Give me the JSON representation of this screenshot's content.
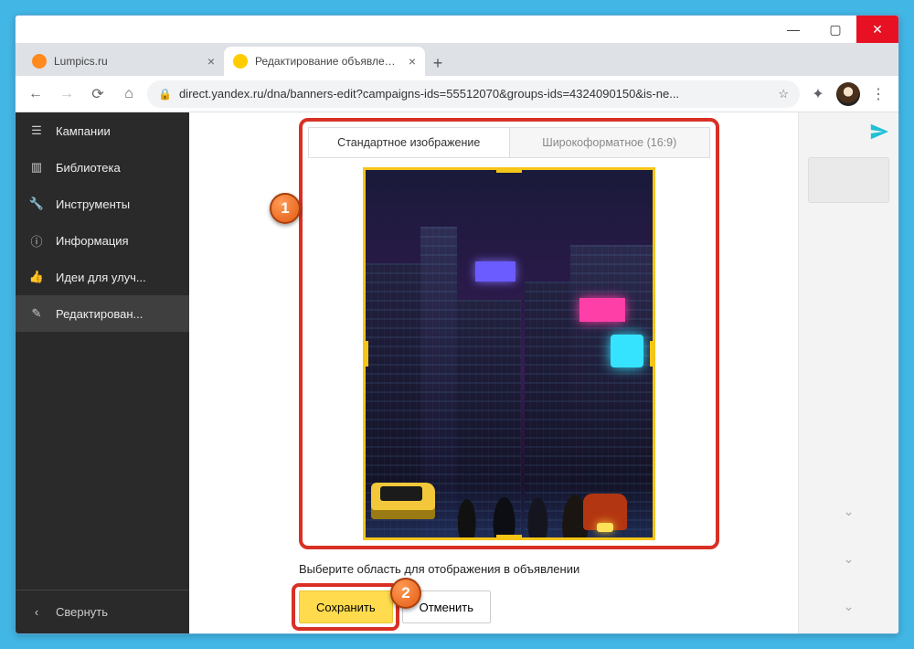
{
  "browser": {
    "tabs": [
      {
        "title": "Lumpics.ru",
        "active": false,
        "favicon_color": "#ff8a1e"
      },
      {
        "title": "Редактирование объявлений",
        "active": true,
        "favicon_color": "#ffcc00"
      }
    ],
    "url": "direct.yandex.ru/dna/banners-edit?campaigns-ids=55512070&groups-ids=4324090150&is-ne..."
  },
  "sidebar": {
    "items": [
      {
        "label": "Кампании",
        "icon": "menu"
      },
      {
        "label": "Библиотека",
        "icon": "books"
      },
      {
        "label": "Инструменты",
        "icon": "wrench"
      },
      {
        "label": "Информация",
        "icon": "info"
      },
      {
        "label": "Идеи для улуч...",
        "icon": "thumb"
      },
      {
        "label": "Редактирован...",
        "icon": "pencil",
        "active": true
      }
    ],
    "collapse_label": "Свернуть"
  },
  "editor": {
    "image_tabs": {
      "standard": "Стандартное изображение",
      "wide": "Широкоформатное (16:9)"
    },
    "hint": "Выберите область для отображения в объявлении",
    "save_label": "Сохранить",
    "cancel_label": "Отменить"
  },
  "annotations": {
    "badge1": "1",
    "badge2": "2"
  }
}
